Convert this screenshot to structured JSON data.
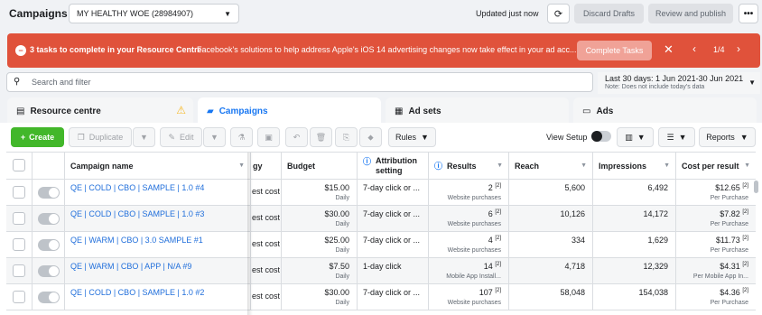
{
  "topbar": {
    "title": "Campaigns",
    "account": "MY HEALTHY WOE (28984907)",
    "updated": "Updated just now",
    "discard_label": "Discard Drafts",
    "review_label": "Review and publish",
    "more_label": "•••"
  },
  "banner": {
    "tasks": "3 tasks to complete in your Resource Centre",
    "message": "Facebook's solutions to help address Apple's iOS 14 advertising changes now take effect in your ad acc...",
    "complete_label": "Complete Tasks",
    "page": "1/4"
  },
  "search": {
    "placeholder": "Search and filter"
  },
  "date_range": {
    "label": "Last 30 days: 1 Jun 2021-30 Jun 2021",
    "note": "Note: Does not include today's data"
  },
  "tabs": [
    {
      "label": "Resource centre"
    },
    {
      "label": "Campaigns"
    },
    {
      "label": "Ad sets"
    },
    {
      "label": "Ads"
    }
  ],
  "toolbar": {
    "create": "Create",
    "duplicate": "Duplicate",
    "edit": "Edit",
    "rules": "Rules",
    "view_setup": "View Setup",
    "reports": "Reports"
  },
  "table": {
    "headers": {
      "name": "Campaign name",
      "strategy": "gy",
      "budget": "Budget",
      "attribution": "Attribution setting",
      "results": "Results",
      "reach": "Reach",
      "impressions": "Impressions",
      "cost": "Cost per result"
    },
    "rows": [
      {
        "name": "QE | COLD | CBO | SAMPLE | 1.0 #4",
        "strategy": "est cost",
        "budget": "$15.00",
        "budget_sub": "Daily",
        "attribution": "7-day click or ...",
        "results": "2",
        "results_sub": "Website purchases",
        "reach": "5,600",
        "impressions": "6,492",
        "cost": "$12.65",
        "cost_sub": "Per Purchase"
      },
      {
        "name": "QE | COLD | CBO | SAMPLE | 1.0 #3",
        "strategy": "est cost",
        "budget": "$30.00",
        "budget_sub": "Daily",
        "attribution": "7-day click or ...",
        "results": "6",
        "results_sub": "Website purchases",
        "reach": "10,126",
        "impressions": "14,172",
        "cost": "$7.82",
        "cost_sub": "Per Purchase"
      },
      {
        "name": "QE | WARM | CBO | 3.0 SAMPLE #1",
        "strategy": "est cost",
        "budget": "$25.00",
        "budget_sub": "Daily",
        "attribution": "7-day click or ...",
        "results": "4",
        "results_sub": "Website purchases",
        "reach": "334",
        "impressions": "1,629",
        "cost": "$11.73",
        "cost_sub": "Per Purchase"
      },
      {
        "name": "QE | WARM | CBO | APP | N/A #9",
        "strategy": "est cost",
        "budget": "$7.50",
        "budget_sub": "Daily",
        "attribution": "1-day click",
        "results": "14",
        "results_sub": "Mobile App Install...",
        "reach": "4,718",
        "impressions": "12,329",
        "cost": "$4.31",
        "cost_sub": "Per Mobile App In..."
      },
      {
        "name": "QE | COLD | CBO | SAMPLE | 1.0 #2",
        "strategy": "est cost",
        "budget": "$30.00",
        "budget_sub": "Daily",
        "attribution": "7-day click or ...",
        "results": "107",
        "results_sub": "Website purchases",
        "reach": "58,048",
        "impressions": "154,038",
        "cost": "$4.36",
        "cost_sub": "Per Purchase"
      }
    ],
    "footnote_mark": "[2]"
  },
  "colors": {
    "banner": "#e0523b",
    "accent": "#1877f2",
    "create": "#42b72a"
  }
}
